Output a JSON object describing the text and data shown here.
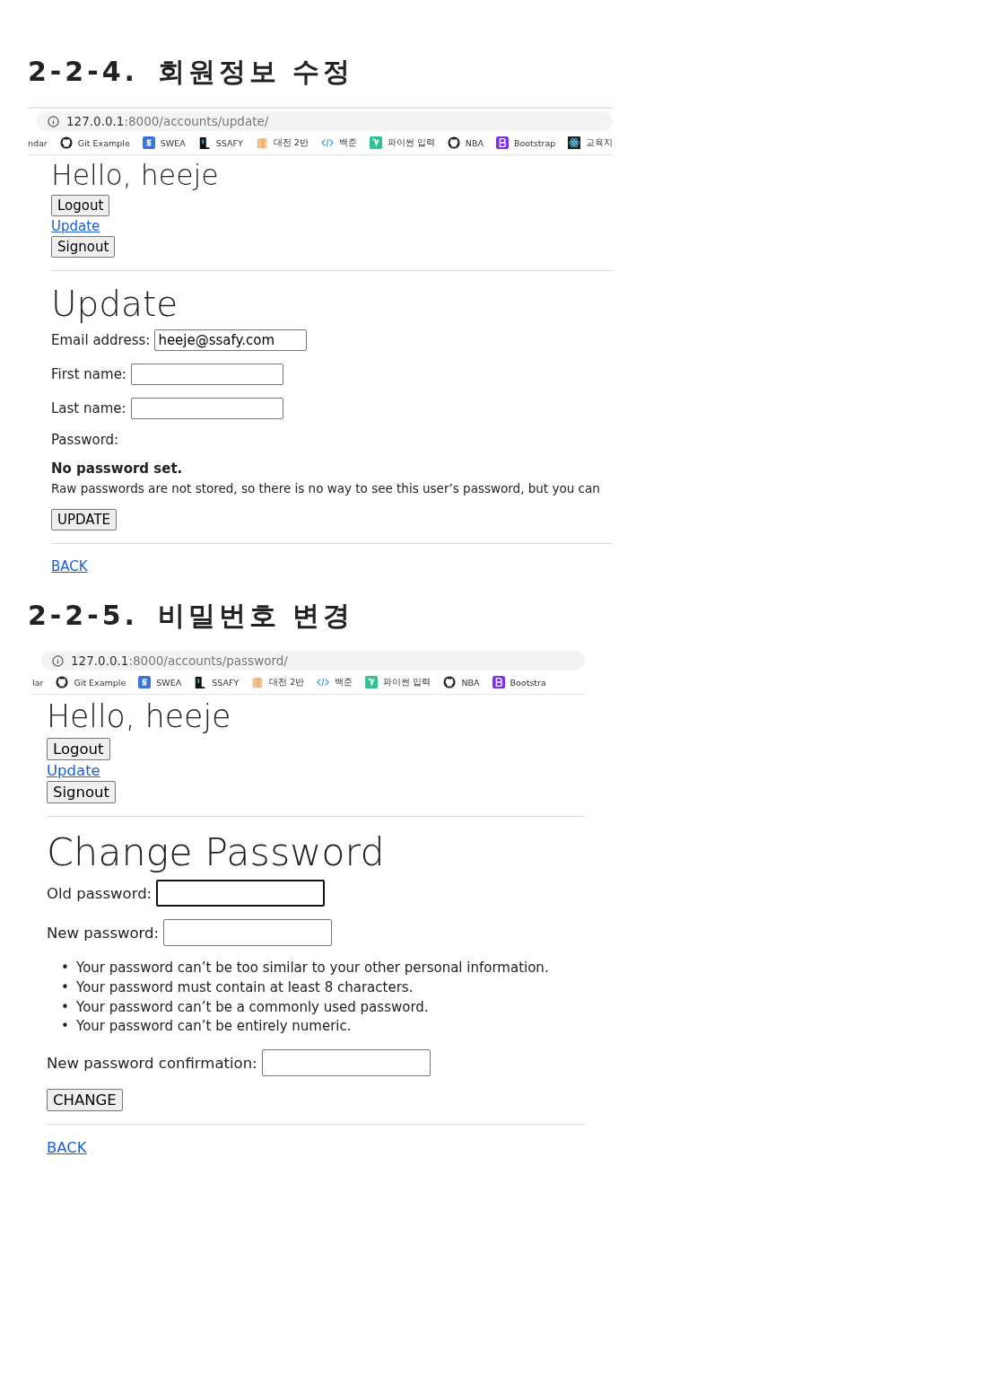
{
  "sections": [
    {
      "heading_number": "2-2-4.",
      "heading_title": "회원정보 수정",
      "screenshot": {
        "url_host": "127.0.0.1",
        "url_path": ":8000/accounts/update/",
        "bookmarks": [
          {
            "kind": "none",
            "label": "ndar"
          },
          {
            "kind": "github",
            "label": "Git Example"
          },
          {
            "kind": "swea",
            "label": "SWEA"
          },
          {
            "kind": "ssafy",
            "label": "SSAFY"
          },
          {
            "kind": "bread",
            "label": "대전 2반"
          },
          {
            "kind": "code",
            "label": "백준"
          },
          {
            "kind": "vee",
            "label": "파이썬 입력"
          },
          {
            "kind": "github",
            "label": "NBA"
          },
          {
            "kind": "bootstrap",
            "label": "Bootstrap"
          },
          {
            "kind": "react",
            "label": "교육지"
          }
        ],
        "greeting": "Hello, heeje",
        "logout": "Logout",
        "update_link": "Update",
        "signout": "Signout",
        "title": "Update",
        "fields": [
          {
            "kind": "input",
            "label": "Email address:",
            "value": "heeje@ssafy.com",
            "focused": false
          },
          {
            "kind": "input",
            "label": "First name:",
            "focused": false
          },
          {
            "kind": "input",
            "label": "Last name:",
            "focused": false
          },
          {
            "kind": "label",
            "label": "Password:"
          },
          {
            "kind": "note",
            "title": "No password set.",
            "text": "Raw passwords are not stored, so there is no way to see this user’s password, but you can"
          }
        ],
        "submit": "UPDATE",
        "back": "BACK"
      }
    },
    {
      "heading_number": "2-2-5.",
      "heading_title": "비밀번호 변경",
      "screenshot": {
        "url_host": "127.0.0.1",
        "url_path": ":8000/accounts/password/",
        "bookmarks": [
          {
            "kind": "none",
            "label": "lar"
          },
          {
            "kind": "github",
            "label": "Git Example"
          },
          {
            "kind": "swea",
            "label": "SWEA"
          },
          {
            "kind": "ssafy",
            "label": "SSAFY"
          },
          {
            "kind": "bread",
            "label": "대전 2반"
          },
          {
            "kind": "code",
            "label": "백준"
          },
          {
            "kind": "vee",
            "label": "파이썬 입력"
          },
          {
            "kind": "github",
            "label": "NBA"
          },
          {
            "kind": "bootstrap",
            "label": "Bootstra"
          }
        ],
        "greeting": "Hello, heeje",
        "logout": "Logout",
        "update_link": "Update",
        "signout": "Signout",
        "title": "Change Password",
        "fields": [
          {
            "kind": "input",
            "label": "Old password:",
            "focused": true
          },
          {
            "kind": "input",
            "label": "New password:",
            "focused": false
          },
          {
            "kind": "list",
            "items": [
              {
                "marker": "•",
                "text": "Your password can’t be too similar to your other personal information."
              },
              {
                "marker": "•",
                "text": "Your password must contain at least 8 characters."
              },
              {
                "marker": "•",
                "text": "Your password can’t be a commonly used password."
              },
              {
                "marker": "•",
                "text": "Your password can’t be entirely numeric."
              }
            ]
          },
          {
            "kind": "input",
            "label": "New password confirmation:",
            "focused": false
          }
        ],
        "submit": "CHANGE",
        "back": "BACK"
      }
    }
  ]
}
